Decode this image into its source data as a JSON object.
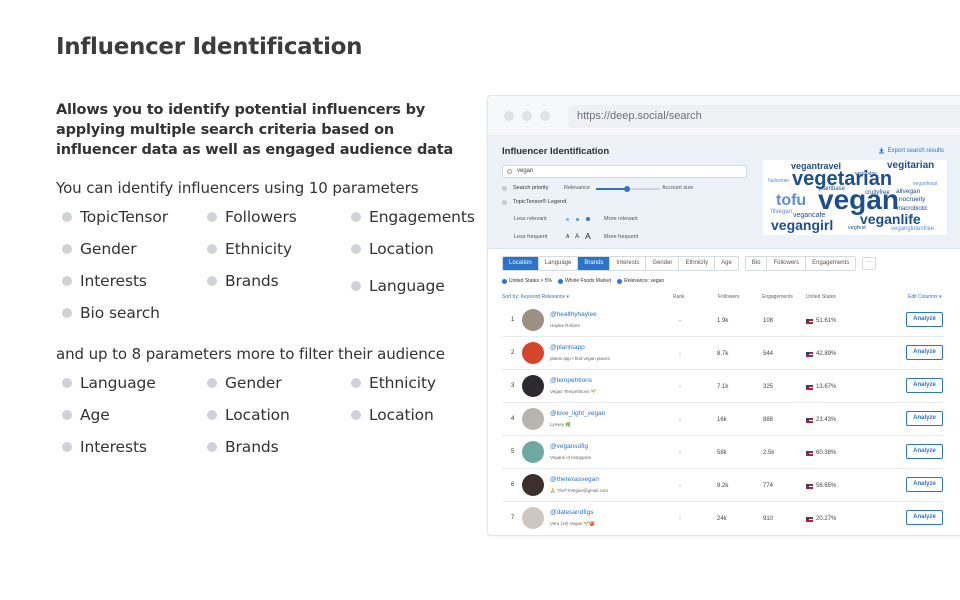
{
  "title": "Influencer Identification",
  "intro": "Allows you to identify potential influencers by applying multiple search criteria based on influencer data as well as engaged audience data",
  "influencer_section": {
    "heading": "You can identify influencers using 10 parameters",
    "params": [
      "TopicTensor",
      "Followers",
      "Engagements",
      "Gender",
      "Ethnicity",
      "Location",
      "Interests",
      "Brands",
      "Language",
      "Bio search"
    ]
  },
  "audience_section": {
    "heading": "and up to 8 parameters more to filter their audience",
    "params": [
      "Language",
      "Gender",
      "Ethnicity",
      "Age",
      "Location",
      "Location",
      "Interests",
      "Brands"
    ]
  },
  "browser": {
    "url": "https://deep.social/search",
    "app_title": "Influencer Identification",
    "export_label": "Export search results",
    "search_value": "vegan",
    "search_priority": {
      "label": "Search priority",
      "left": "Relevance",
      "right": "Account size"
    },
    "legend": {
      "label": "TopicTensor® Legend",
      "less_relevant": "Less relevant",
      "more_relevant": "More relevant",
      "less_frequent": "Less frequent",
      "more_frequent": "More frequent",
      "freq_letters": [
        "A",
        "A",
        "A"
      ]
    },
    "word_cloud": [
      "vegantravel",
      "veganday",
      "vegitarian",
      "hailseitan",
      "vegetarian",
      "plantbase",
      "veganfeast",
      "crultyfree",
      "allvegan",
      "nocrueity",
      "tofu",
      "vegan",
      "macrobiotic",
      "fitvegan",
      "veganlife",
      "vegancafe",
      "vegangirl",
      "vegfest",
      "veganglutenfree"
    ],
    "filter_tabs": [
      "Location",
      "Language",
      "Brands",
      "Interests",
      "Gender",
      "Ethnicity",
      "Age"
    ],
    "active_tabs": [
      "Location",
      "Brands"
    ],
    "filter_tabs_2": [
      "Bio",
      "Followers",
      "Engagements"
    ],
    "more_label": "···",
    "applied_tags": [
      "United States > 5%",
      "Whole Foods Market",
      "Relevance: vegan"
    ],
    "table_headers": {
      "sort": "Sort by: Keyword Relevance ▾",
      "rank": "Rank",
      "followers": "Followers",
      "engagements": "Engagements",
      "country": "United States",
      "edit": "Edit Columns ▾"
    },
    "rows": [
      {
        "num": "1",
        "handle": "@healthyhaylee",
        "name": "Haylee Rohren",
        "rank": "-",
        "followers": "1.9k",
        "engagements": "108",
        "country_pct": "51.61%",
        "action": "Analyze",
        "avatar_color": "#9c8f83"
      },
      {
        "num": "2",
        "handle": "@plantsapp",
        "name": "plants app • find vegan places",
        "rank": "-",
        "followers": "8.7k",
        "engagements": "544",
        "country_pct": "42.89%",
        "action": "Analyze",
        "avatar_color": "#d4452c"
      },
      {
        "num": "3",
        "handle": "@tempehtions",
        "name": "Vegan Tempehtions 🌱",
        "rank": "-",
        "followers": "7.1k",
        "engagements": "325",
        "country_pct": "13.67%",
        "action": "Analyze",
        "avatar_color": "#2c2a2f"
      },
      {
        "num": "4",
        "handle": "@love_light_vegan",
        "name": "Lynsey 🌿",
        "rank": "-",
        "followers": "16k",
        "engagements": "888",
        "country_pct": "23.43%",
        "action": "Analyze",
        "avatar_color": "#b8b5b0"
      },
      {
        "num": "5",
        "handle": "@vegansofig",
        "name": "Vegans of Instagram",
        "rank": "-",
        "followers": "58k",
        "engagements": "2.5k",
        "country_pct": "60.38%",
        "action": "Analyze",
        "avatar_color": "#6fa9a3"
      },
      {
        "num": "6",
        "handle": "@thetexasvegan",
        "name": "🙏 TheTXVegan@gmail.com",
        "rank": "-",
        "followers": "8.2k",
        "engagements": "774",
        "country_pct": "56.65%",
        "action": "Analyze",
        "avatar_color": "#3d2f29"
      },
      {
        "num": "7",
        "handle": "@datesandfigs",
        "name": "Vera (19) Vegan 🌱🍑",
        "rank": "-",
        "followers": "24k",
        "engagements": "910",
        "country_pct": "20.27%",
        "action": "Analyze",
        "avatar_color": "#cfc6c0"
      }
    ]
  },
  "colors": {
    "accent": "#2c74c9",
    "cloud_dark": "#1f4e8c",
    "cloud_light": "#5a8fd6"
  }
}
